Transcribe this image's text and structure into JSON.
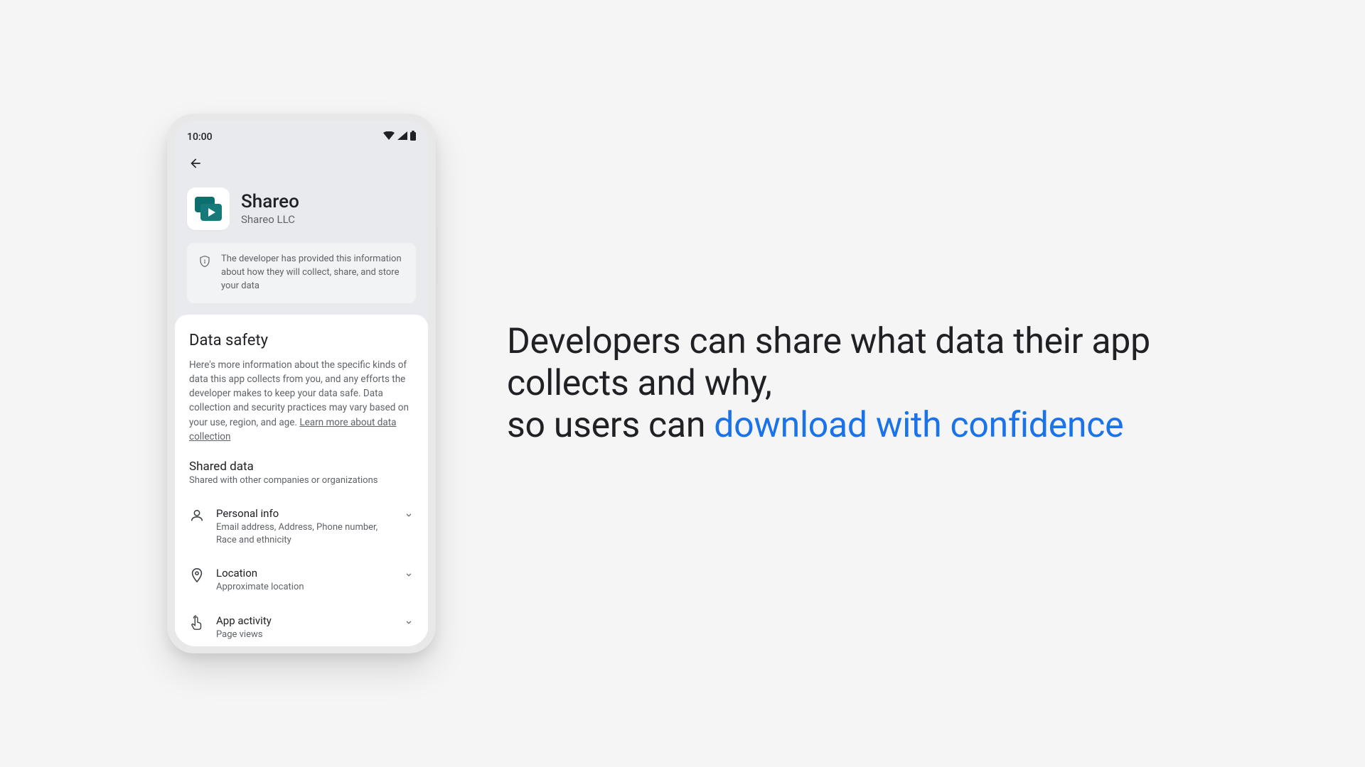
{
  "status": {
    "time": "10:00"
  },
  "app": {
    "name": "Shareo",
    "developer": "Shareo LLC"
  },
  "info_banner": {
    "text": "The developer has provided this information about how they will collect, share, and store your data"
  },
  "data_safety": {
    "heading": "Data safety",
    "body": "Here's more information about the specific kinds of data this app collects from you, and any efforts the developer makes to keep your data safe. Data collection and security practices may vary based on your use, region, and age. ",
    "learn_more": "Learn more about data collection"
  },
  "shared_data": {
    "heading": "Shared data",
    "subheading": "Shared with other companies or organizations",
    "rows": [
      {
        "icon": "person",
        "title": "Personal info",
        "desc": "Email address, Address, Phone number, Race and ethnicity"
      },
      {
        "icon": "location",
        "title": "Location",
        "desc": "Approximate location"
      },
      {
        "icon": "touch",
        "title": "App activity",
        "desc": "Page views"
      }
    ]
  },
  "marketing": {
    "line1": "Developers can share what data their app collects and why,",
    "line2_prefix": "so users can ",
    "line2_highlight": "download with confidence"
  }
}
